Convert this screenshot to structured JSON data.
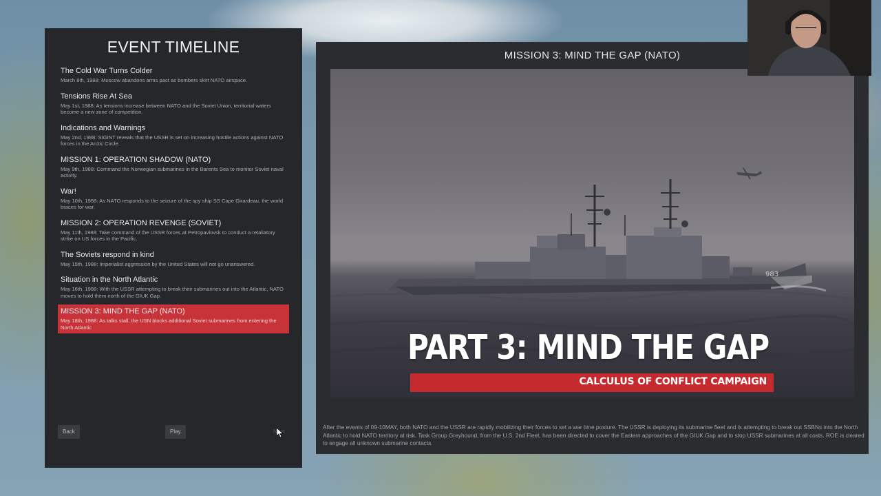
{
  "timeline": {
    "title": "EVENT TIMELINE",
    "events": [
      {
        "title": "The Cold War Turns Colder",
        "desc": "March 8th, 1988: Moscow abandons arms pact as bombers skirt NATO airspace."
      },
      {
        "title": "Tensions Rise At Sea",
        "desc": "May 1st, 1988: As tensions increase between NATO and the Soviet Union, territorial waters become a new zone of competition."
      },
      {
        "title": "Indications and Warnings",
        "desc": "May 2nd, 1988: SIGINT reveals that the USSR is set on increasing hostile actions against NATO forces in the Arctic Circle."
      },
      {
        "title": "MISSION 1: OPERATION SHADOW (NATO)",
        "desc": "May 9th, 1988: Command the Norwegian submarines in the Barents Sea to monitor Soviet naval activity."
      },
      {
        "title": "War!",
        "desc": "May 10th, 1988: As NATO responds to the seizure of the spy ship SS Cape Girardeau, the world braces for war."
      },
      {
        "title": "MISSION 2: OPERATION REVENGE (SOVIET)",
        "desc": "May 11th, 1988: Take command of the USSR forces at Petropavlovsk to conduct a retaliatory strike on US forces in the Pacific."
      },
      {
        "title": "The Soviets respond in kind",
        "desc": "May 15th, 1988: Imperialist aggression by the United States will not go unanswered."
      },
      {
        "title": "Situation in the North Atlantic",
        "desc": "May 16th, 1988: With the USSR attempting to break their submarines out into the Atlantic, NATO moves to hold them north of the GIUK Gap."
      },
      {
        "title": "MISSION 3: MIND THE GAP (NATO)",
        "desc": "May 18th, 1988: As talks stall, the USN blocks additional Soviet submarines from entering the North Atlantic"
      }
    ],
    "buttons": {
      "back": "Back",
      "play": "Play",
      "next": "Next"
    }
  },
  "mission": {
    "title": "MISSION 3: MIND THE GAP (NATO)",
    "image_title": "PART 3: MIND THE GAP",
    "image_subtitle": "CALCULUS OF CONFLICT CAMPAIGN",
    "hull_number": "983",
    "description": "After the events of 09-10MAY, both NATO and the USSR are rapidly mobilizing their forces to set a war time posture. The USSR is deploying its submarine fleet and is attempting to break out SSBNs into the North Atlantic to hold NATO territory at risk. Task Group Greyhound, from the U.S. 2nd Fleet, has been directed to cover the Eastern approaches of the GIUK Gap and to stop USSR submarines at all costs. ROE is cleared to engage all unknown submarine contacts."
  },
  "colors": {
    "selected": "#c8333a",
    "banner": "#c42a2e",
    "panel": "#25272b"
  }
}
